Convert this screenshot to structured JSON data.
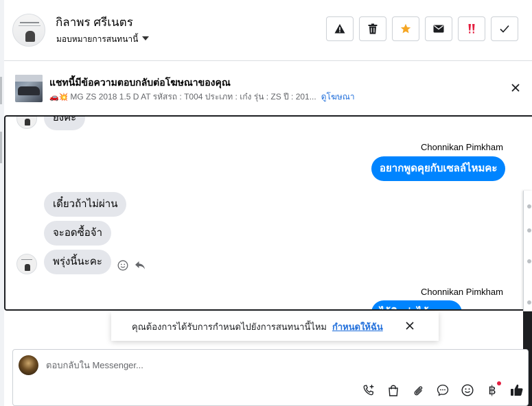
{
  "header": {
    "name": "กิลาพร ศรีเนตร",
    "assign_label": "มอบหมายการสนทนานี้"
  },
  "ad": {
    "title": "แชทนี้มีข้อความตอบกลับต่อโฆษณาของคุณ",
    "subtitle": "MG ZS 2018 1.5 D AT รหัสรถ : T004 ประเภท : เก๋ง รุ่น : ZS ปี : 201...",
    "emoji": "🚗💥",
    "link": "ดูโฆษณา"
  },
  "conversation": {
    "partial_top": "ยังคะ",
    "outgoing_1": {
      "sender": "Chonnikan Pimkham",
      "text": "อยากพูดคุยกับเซลล์ไหมคะ"
    },
    "incoming": [
      "เดี๋ยวถ้าไม่ผ่าน",
      "จะอดซื้อจ้า",
      "พรุ่งนี้นะคะ"
    ],
    "outgoing_2": {
      "sender": "Chonnikan Pimkham",
      "text": "ไว้ติดต่อได้นะคะ"
    }
  },
  "toast": {
    "text": "คุณต้องการได้รับการกำหนดไปยังการสนทนานี้ไหม",
    "link": "กำหนดให้ฉัน"
  },
  "composer": {
    "placeholder": "ตอบกลับใน Messenger...",
    "baht_symbol": "฿"
  },
  "colors": {
    "accent": "#0084ff",
    "incoming_bubble": "#e4e6eb",
    "link": "#216fdb",
    "star": "#f5a623",
    "alert": "#e41e3f"
  }
}
